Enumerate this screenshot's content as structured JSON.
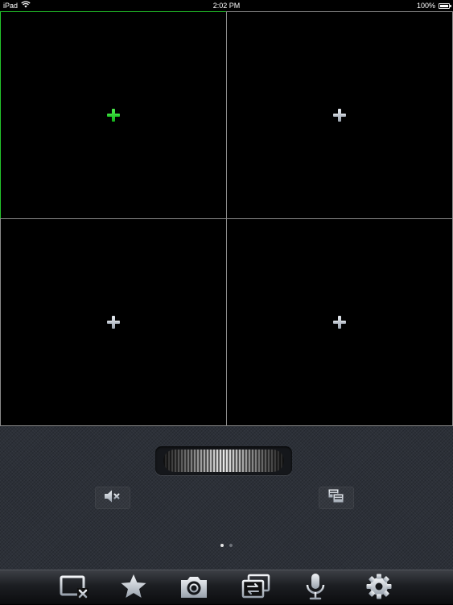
{
  "status_bar": {
    "carrier": "iPad",
    "time": "2:02 PM",
    "battery": "100%",
    "battery_level": 1.0,
    "wifi_icon": "wifi-icon"
  },
  "video_grid": {
    "layout": "2x2",
    "selected_index": 0,
    "cells": [
      {
        "icon": "add-camera-icon",
        "selected": true
      },
      {
        "icon": "add-camera-icon",
        "selected": false
      },
      {
        "icon": "add-camera-icon",
        "selected": false
      },
      {
        "icon": "add-camera-icon",
        "selected": false
      }
    ],
    "colors": {
      "selected_border": "#23c52b",
      "border": "#8a8a8a"
    }
  },
  "control_panel": {
    "ptz_wheel_icon": "ptz-wheel-icon",
    "audio_button_icon": "speaker-muted-icon",
    "layout_button_icon": "multi-screen-icon",
    "page_count": 2,
    "current_page": 0
  },
  "toolbar": {
    "items": [
      {
        "icon": "close-view-icon"
      },
      {
        "icon": "star-icon"
      },
      {
        "icon": "camera-icon"
      },
      {
        "icon": "switch-view-icon"
      },
      {
        "icon": "microphone-icon"
      },
      {
        "icon": "gear-icon"
      }
    ]
  }
}
